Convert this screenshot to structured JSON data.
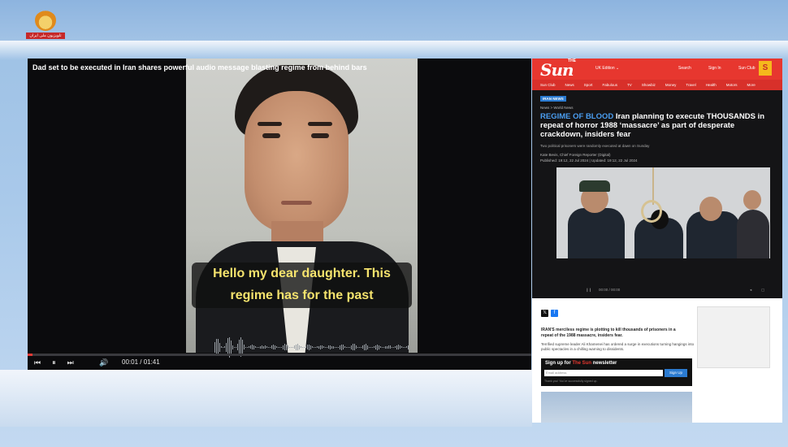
{
  "channel": {
    "logo_text": "تلویزیون ملی ایران"
  },
  "video": {
    "title": "Dad set to be executed in Iran shares powerful audio message blasting regime from behind bars",
    "subtitle_line1": "Hello my dear daughter. This",
    "subtitle_line2": "regime has for the past",
    "time": "00:01 / 01:41",
    "progress_percent": 1
  },
  "sun": {
    "logo": "Sun",
    "logo_the": "THE",
    "edition": "UK Edition ⌄",
    "search": "Search",
    "sign_in": "Sign In",
    "sun_club": "Sun Club",
    "badge": "S",
    "nav": [
      "Sun Club",
      "News",
      "Sport",
      "Fabulous",
      "TV",
      "Showbiz",
      "Money",
      "Travel",
      "Health",
      "Motors",
      "More"
    ],
    "tag": "IRAN NEWS",
    "breadcrumb": "News  >  World News",
    "kicker": "REGIME OF BLOOD",
    "headline": " Iran planning to execute THOUSANDS in repeat of horror 1988 ‘massacre’ as part of desperate crackdown, insiders fear",
    "standfirst": "Two political prisoners were randomly executed at dawn on Sunday",
    "byline": "Kate Bevis, Chief Foreign Reporter (Digital)",
    "published": "Published: 19:12, 22 Jul 2024  |  Updated: 19:12, 22 Jul 2024",
    "player_time": "00:00 / 00:00",
    "lead": "IRAN'S merciless regime is plotting to kill thousands of prisoners in a repeat of the 1988 massacre, insiders fear.",
    "body": "Terrified supreme leader Ali Khamenei has ordered a surge in executions turning hangings into public spectacles in a chilling warning to dissidents.",
    "newsletter_prefix": "Sign up for",
    "newsletter_brand": "The Sun",
    "newsletter_suffix": "newsletter",
    "email_placeholder": "Email address",
    "signup_button": "Sign Up",
    "fine_print": "Thank you! You've successfully signed up."
  },
  "page_number": "1",
  "colors": {
    "sun_red": "#e7372f",
    "subtitle_yellow": "#f5e36d",
    "kicker_blue": "#4a9df0"
  }
}
